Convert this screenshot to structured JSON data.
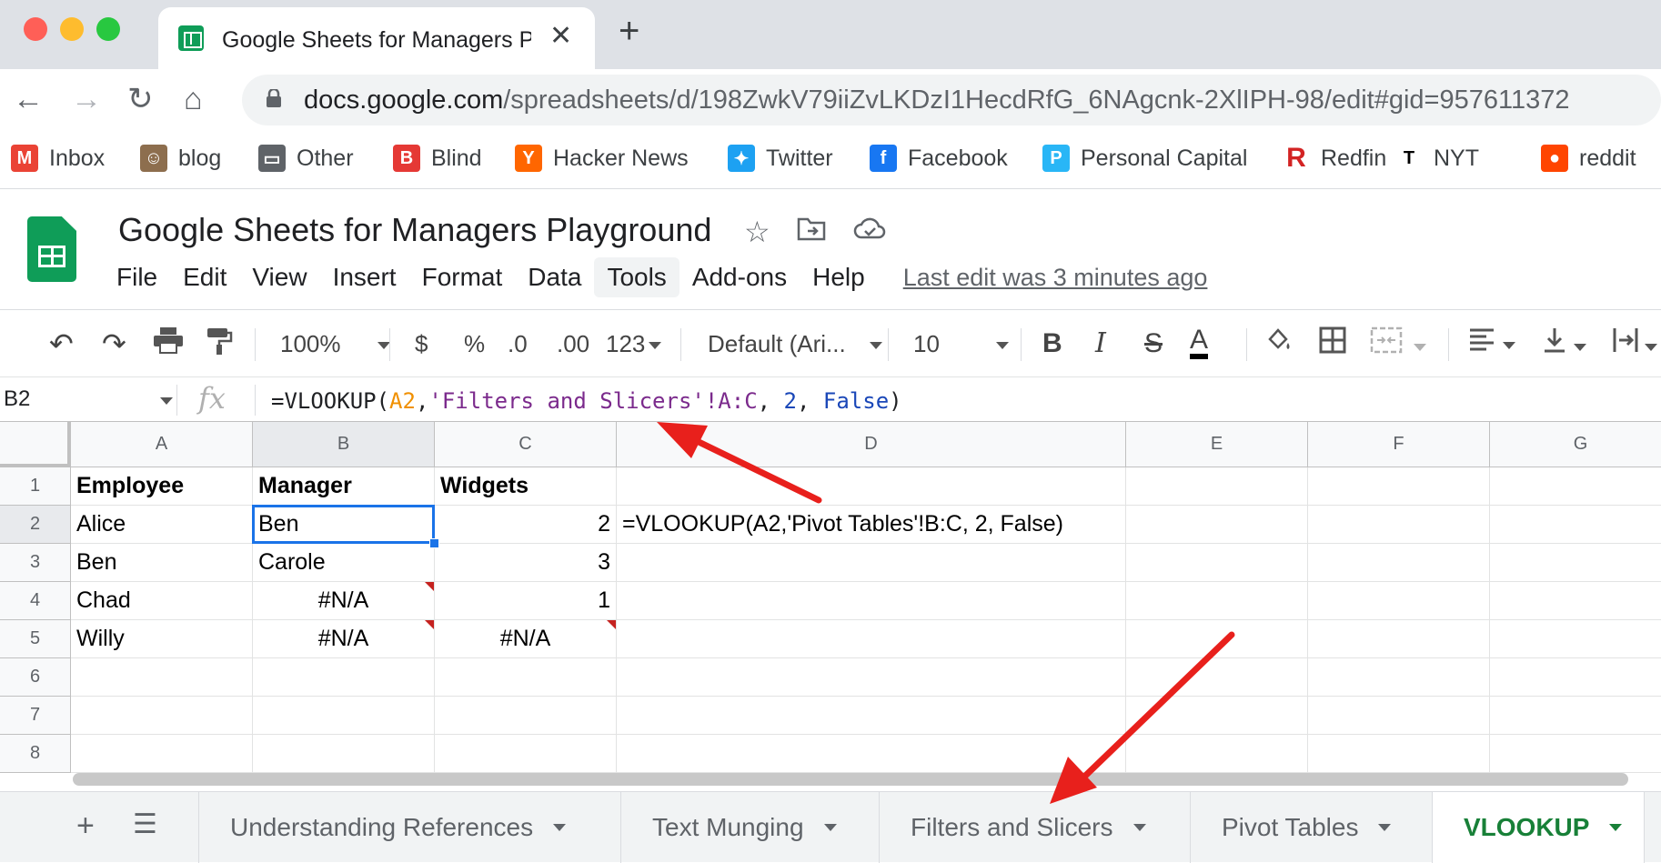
{
  "browser": {
    "tab_title": "Google Sheets for Managers Pl",
    "url_host": "docs.google.com",
    "url_path": "/spreadsheets/d/198ZwkV79iiZvLKDzI1HecdRfG_6NAgcnk-2XlIPH-98/edit#gid=957611372"
  },
  "bookmarks": [
    {
      "label": "Inbox",
      "icon": "gmail-icon",
      "color": "#ea4335"
    },
    {
      "label": "blog",
      "icon": "avatar-icon",
      "color": "#8d6e4e"
    },
    {
      "label": "Other",
      "icon": "folder-icon",
      "color": "#5f6368"
    },
    {
      "label": "Blind",
      "icon": "blind-icon",
      "color": "#e53935"
    },
    {
      "label": "Hacker News",
      "icon": "hackernews-icon",
      "color": "#ff6600"
    },
    {
      "label": "Twitter",
      "icon": "twitter-icon",
      "color": "#1da1f2"
    },
    {
      "label": "Facebook",
      "icon": "facebook-icon",
      "color": "#1877f2"
    },
    {
      "label": "Personal Capital",
      "icon": "personalcapital-icon",
      "color": "#29b6f6"
    },
    {
      "label": "Redfin",
      "icon": "redfin-icon",
      "color": "#d32323"
    },
    {
      "label": "NYT",
      "icon": "nyt-icon",
      "color": "#000000"
    },
    {
      "label": "reddit",
      "icon": "reddit-icon",
      "color": "#ff4500"
    }
  ],
  "doc": {
    "title": "Google Sheets for Managers Playground",
    "menu": [
      "File",
      "Edit",
      "View",
      "Insert",
      "Format",
      "Data",
      "Tools",
      "Add-ons",
      "Help"
    ],
    "active_menu": "Tools",
    "last_edit": "Last edit was 3 minutes ago"
  },
  "toolbar": {
    "zoom": "100%",
    "currency": "$",
    "percent": "%",
    "dec_less": ".0",
    "dec_more": ".00",
    "more_formats": "123",
    "font": "Default (Ari...",
    "font_size": "10",
    "bold": "B",
    "italic": "I",
    "strike": "S",
    "text_color": "A"
  },
  "formula_bar": {
    "name_box": "B2",
    "fx": "fx",
    "formula_parts": {
      "p1": "=VLOOKUP(",
      "ref": "A2",
      "p2": ",",
      "str": "'Filters and Slicers'!A:C",
      "p3": ", ",
      "num": "2",
      "p4": ", ",
      "bool": "False",
      "p5": ")"
    }
  },
  "grid": {
    "columns": [
      "A",
      "B",
      "C",
      "D",
      "E",
      "F",
      "G"
    ],
    "rows": [
      "1",
      "2",
      "3",
      "4",
      "5",
      "6",
      "7",
      "8"
    ],
    "cells": {
      "A1": "Employee",
      "B1": "Manager",
      "C1": "Widgets",
      "A2": "Alice",
      "B2": "Ben",
      "C2": "2",
      "D2": "=VLOOKUP(A2,'Pivot Tables'!B:C, 2, False)",
      "A3": "Ben",
      "B3": "Carole",
      "C3": "3",
      "A4": "Chad",
      "B4": "#N/A",
      "C4": "1",
      "A5": "Willy",
      "B5": "#N/A",
      "C5": "#N/A"
    },
    "selected_cell": "B2"
  },
  "sheet_tabs": [
    "Understanding References",
    "Text Munging",
    "Filters and Slicers",
    "Pivot Tables",
    "VLOOKUP"
  ],
  "active_sheet": "VLOOKUP",
  "colors": {
    "annotation_arrow": "#e8201c",
    "selection": "#1a73e8",
    "active_tab": "#188038"
  }
}
